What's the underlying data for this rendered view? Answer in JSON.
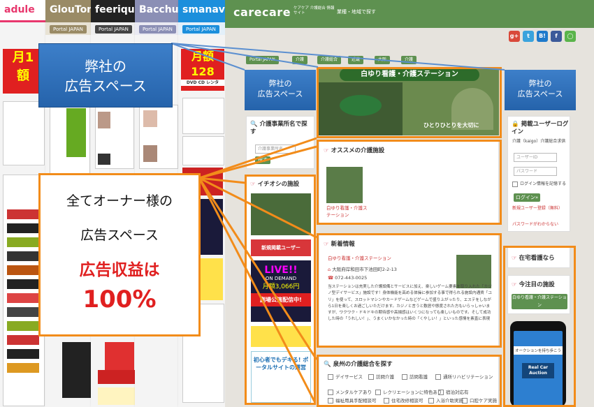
{
  "sites": [
    {
      "name": "adule",
      "color": "#e8376d",
      "portal": "",
      "promo_big": "月1",
      "promo_small": "額"
    },
    {
      "name": "GlouTon",
      "color": "#9a8b66",
      "portal": "Portal JAPAN"
    },
    {
      "name": "feeriqu",
      "color": "#222222",
      "portal": "Portal JAPAN"
    },
    {
      "name": "Bacchus",
      "color": "#8b8fb5",
      "portal": "Portal JAPAN"
    },
    {
      "name": "smanavi",
      "color": "#1c8fdc",
      "portal": "Portal JAPAN",
      "promo_big": "月額128",
      "promo_sub": "DVD CD レンタ"
    }
  ],
  "carecare": {
    "logo": "carecare",
    "logo_sub": "ケアケア 介護総合 情報サイト",
    "nav": "業種・地域で探す",
    "social": [
      {
        "label": "g+",
        "color": "#d9493a"
      },
      {
        "label": "t",
        "color": "#3aa3dd"
      },
      {
        "label": "B!",
        "color": "#1f7acb"
      },
      {
        "label": "f",
        "color": "#3c5a9a"
      },
      {
        "label": "◯",
        "color": "#5ab44a"
      }
    ],
    "breadcrumbs": [
      "Portal JAPAN",
      "介護",
      "介護総合",
      "近畿",
      "大阪",
      "介護"
    ],
    "search_panel": {
      "title": "介護事業所名で探す",
      "placeholder": "介護事業所名",
      "button": "探す"
    },
    "ichioshi": {
      "title": "イチオシの施設",
      "banner1": "新規掲載ユーザー",
      "banner2_top": "LIVE!!",
      "banner2_mid": "ON DEMAND",
      "banner2_price": "月額3,066円",
      "banner2_bottom": "劇場公演配信中!",
      "banner3": "初心者でもデキる! ポータルサイトの運営"
    },
    "hero": {
      "title": "白ゆり看護・介護ステーション",
      "tagline": "ひとりひとりを大切に"
    },
    "recommend": {
      "title": "オススメの介護施設",
      "item": "白ゆり看護・介護ステーション"
    },
    "news": {
      "title": "新着情報",
      "item_title": "白ゆり看護・介護ステーション",
      "address": "大阪府岸和田市下池田町2-2-13",
      "phone": "072-443-0025",
      "body": "当ステーションは充実した介護設備とサービスに加え、楽しいゲーム要素を取り入れた「カジノ型デイサービス」施設です！身体機能を高める体操に参加する事で得られる施設内通貨「ユリ」を使って、スロットマシンやカードゲームなどゲームで盛り上がったり、エステをしながら1日を楽しくお過ごしいただけます。カジノと言うと敷居や態度された方もいらっしゃいますが、ワクワク・ドキドキの期待感や高揚感はいくつになっても楽しいものです。そして成功した時の「うれしい！」、うまくいかなかった時の「くやしい！」といった感情を素直に表現"
    },
    "area": {
      "title": "泉州の介護総合を探す",
      "options": [
        "デイサービス",
        "訪問介護",
        "訪問看護",
        "通所リハビリテーション",
        "メンタルケアあり",
        "レクリエーションに特色あり",
        "宿泊対応有",
        "福祉用具手配相談可",
        "住宅改修相談可",
        "入浴介助実施",
        "口腔ケア実施"
      ]
    },
    "login": {
      "title": "掲載ユーザーログイン",
      "desc": "介護（kaigo）介護総合求供",
      "user_placeholder": "ユーザーID",
      "pass_placeholder": "パスワード",
      "remember": "ログイン情報を記憶する",
      "button": "ログイン»",
      "new_reg": "新規ユーザー登録（無料）",
      "forgot": "パスワードがわからない"
    },
    "home_nursing": {
      "title": "在宅看護なら"
    },
    "featured": {
      "title": "今注目の施設",
      "button": "白ゆり看護・介護ステーション"
    },
    "phone_ad": {
      "top": "オークションを持ち歩こう",
      "logo": "Real Car Auction"
    }
  },
  "overlays": {
    "ad_space_big": "弊社の\n広告スペース",
    "ad_space_left": "弊社の\n広告スペース",
    "ad_space_right": "弊社の\n広告スペース",
    "owner_line1": "全てオーナー様の",
    "owner_line2": "広告スペース",
    "revenue_line1": "広告収益は",
    "revenue_line2": "100%"
  },
  "colors": {
    "orange": "#f28c1a",
    "blue": "#2f6fb8",
    "green": "#5e9150",
    "red": "#e02020"
  }
}
